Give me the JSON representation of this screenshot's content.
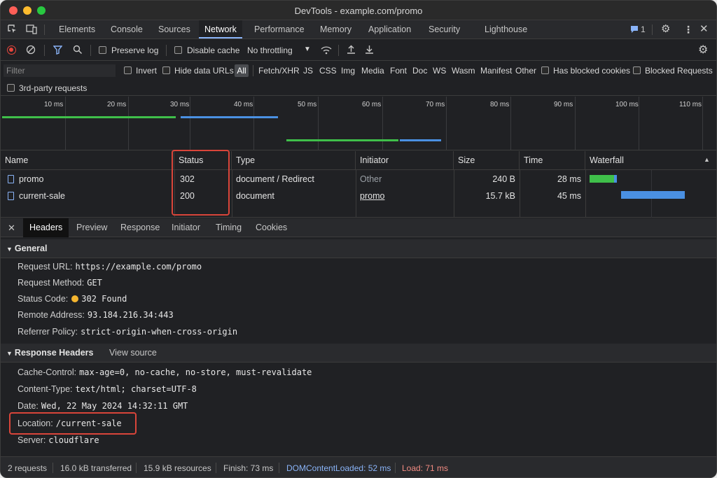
{
  "window": {
    "title": "DevTools - example.com/promo"
  },
  "colors": {
    "close": "#ff5f57",
    "minimize": "#febc2e",
    "maximize": "#28c840",
    "accent": "#8ab4f8",
    "record": "#e8453c",
    "highlight": "#d9453a"
  },
  "main_tabs": [
    "Elements",
    "Console",
    "Sources",
    "Network",
    "Performance",
    "Memory",
    "Application",
    "Security",
    "Lighthouse"
  ],
  "active_main_tab": "Network",
  "issues_count": "1",
  "toolbar": {
    "preserve_log": "Preserve log",
    "disable_cache": "Disable cache",
    "throttling": "No throttling"
  },
  "filter": {
    "placeholder": "Filter",
    "invert": "Invert",
    "hide_data_urls": "Hide data URLs",
    "types": [
      "All",
      "Fetch/XHR",
      "JS",
      "CSS",
      "Img",
      "Media",
      "Font",
      "Doc",
      "WS",
      "Wasm",
      "Manifest",
      "Other"
    ],
    "has_blocked_cookies": "Has blocked cookies",
    "blocked_requests": "Blocked Requests",
    "third_party": "3rd-party requests"
  },
  "timeline": {
    "ticks": [
      "10 ms",
      "20 ms",
      "30 ms",
      "40 ms",
      "50 ms",
      "60 ms",
      "70 ms",
      "80 ms",
      "90 ms",
      "100 ms",
      "110 ms"
    ]
  },
  "table": {
    "headers": [
      "Name",
      "Status",
      "Type",
      "Initiator",
      "Size",
      "Time",
      "Waterfall"
    ],
    "rows": [
      {
        "name": "promo",
        "status": "302",
        "type": "document / Redirect",
        "initiator": "Other",
        "size": "240 B",
        "time": "28 ms"
      },
      {
        "name": "current-sale",
        "status": "200",
        "type": "document",
        "initiator": "promo",
        "size": "15.7 kB",
        "time": "45 ms"
      }
    ]
  },
  "detail_tabs": [
    "Headers",
    "Preview",
    "Response",
    "Initiator",
    "Timing",
    "Cookies"
  ],
  "active_detail_tab": "Headers",
  "general": {
    "title": "General",
    "request_url_key": "Request URL:",
    "request_url": "https://example.com/promo",
    "method_key": "Request Method:",
    "method": "GET",
    "status_key": "Status Code:",
    "status": "302 Found",
    "remote_key": "Remote Address:",
    "remote": "93.184.216.34:443",
    "referrer_key": "Referrer Policy:",
    "referrer": "strict-origin-when-cross-origin"
  },
  "response_headers": {
    "title": "Response Headers",
    "view_source": "View source",
    "cache_key": "Cache-Control:",
    "cache": "max-age=0, no-cache, no-store, must-revalidate",
    "content_type_key": "Content-Type:",
    "content_type": "text/html; charset=UTF-8",
    "date_key": "Date:",
    "date": "Wed, 22 May 2024 14:32:11 GMT",
    "location_key": "Location:",
    "location": "/current-sale",
    "server_key": "Server:",
    "server": "cloudflare"
  },
  "status_bar": {
    "requests": "2 requests",
    "transferred": "16.0 kB transferred",
    "resources": "15.9 kB resources",
    "finish": "Finish: 73 ms",
    "dom": "DOMContentLoaded: 52 ms",
    "load": "Load: 71 ms"
  }
}
